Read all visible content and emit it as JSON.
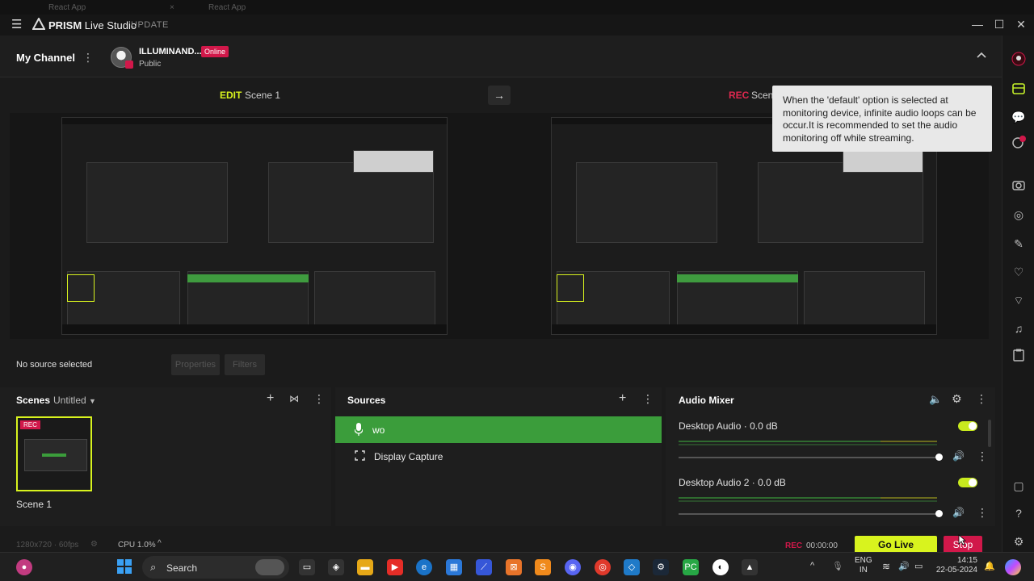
{
  "topstrip": {
    "tab1": "React App",
    "tab2": "React App"
  },
  "titlebar": {
    "app_name_bold": "PRISM",
    "app_name_light": "Live Studio",
    "update_label": "UPDATE",
    "minimize": "—",
    "maximize": "☐",
    "close": "✕"
  },
  "channel": {
    "title": "My Channel",
    "account_name": "ILLUMINAND...",
    "visibility": "Public",
    "status_badge": "Online"
  },
  "scenes_header": {
    "edit_label": "EDIT",
    "edit_scene": "Scene 1",
    "rec_label": "REC",
    "rec_scene": "Scene"
  },
  "tooltip": {
    "text": "When the 'default' option is selected at monitoring device, infinite audio loops can be occur.It is recommended to set the audio monitoring off while streaming."
  },
  "source_bar": {
    "no_source": "No source selected",
    "properties": "Properties",
    "filters": "Filters"
  },
  "scenes_dock": {
    "title": "Scenes",
    "collection": "Untitled",
    "scene_name": "Scene 1",
    "rec_badge": "REC"
  },
  "sources_dock": {
    "title": "Sources",
    "items": [
      {
        "name": "wo",
        "icon": "microphone-icon"
      },
      {
        "name": "Display Capture",
        "icon": "display-capture-icon"
      }
    ]
  },
  "audio_mixer": {
    "title": "Audio Mixer",
    "channels": [
      {
        "name": "Desktop Audio",
        "level": "0.0 dB"
      },
      {
        "name": "Desktop Audio 2",
        "level": "0.0 dB"
      }
    ]
  },
  "statusbar": {
    "resolution": "1280x720 · 60fps",
    "cpu": "CPU 1.0%",
    "rec_label": "REC",
    "rec_time": "00:00:00",
    "go_live": "Go Live",
    "stop": "Stop"
  },
  "taskbar": {
    "search_placeholder": "Search",
    "lang1": "ENG",
    "lang2": "IN",
    "time": "14:15",
    "date": "22-05-2024"
  },
  "colors": {
    "accent": "#d8f31e",
    "rec_red": "#d1184a",
    "source_green": "#3b9d3b",
    "background": "#1b1b1b"
  }
}
